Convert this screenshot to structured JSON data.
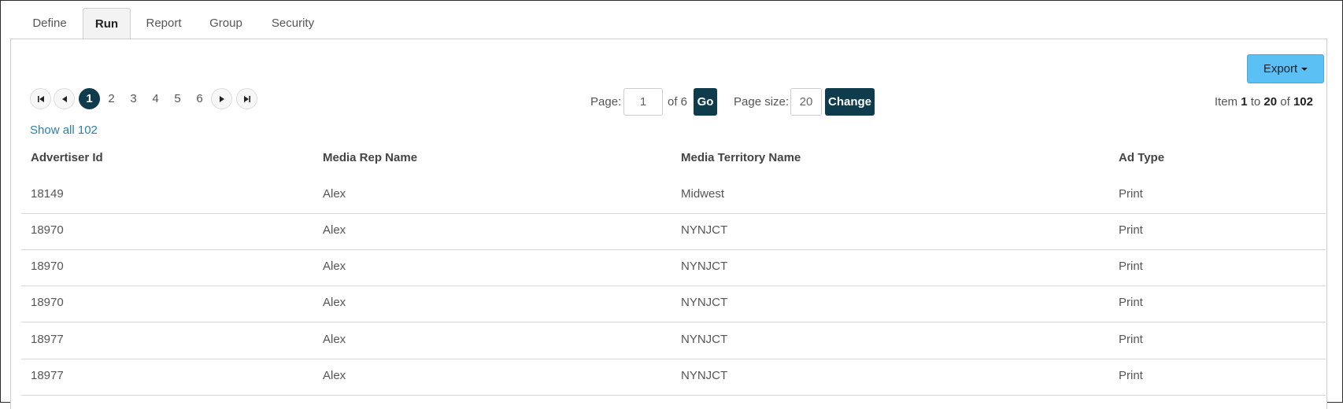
{
  "tabs": [
    {
      "label": "Define",
      "active": false
    },
    {
      "label": "Run",
      "active": true
    },
    {
      "label": "Report",
      "active": false
    },
    {
      "label": "Group",
      "active": false
    },
    {
      "label": "Security",
      "active": false
    }
  ],
  "export": {
    "label": "Export"
  },
  "pager": {
    "pages": [
      "1",
      "2",
      "3",
      "4",
      "5",
      "6"
    ],
    "current": "1",
    "show_all": "Show all 102"
  },
  "page_nav": {
    "page_label": "Page:",
    "page_value": "1",
    "of_label": "of 6",
    "go_label": "Go",
    "size_label": "Page size:",
    "size_value": "20",
    "change_label": "Change"
  },
  "range": {
    "item": "Item",
    "start": "1",
    "to": "to",
    "end": "20",
    "of": "of",
    "total": "102"
  },
  "table": {
    "columns": [
      "Advertiser Id",
      "Media Rep Name",
      "Media Territory Name",
      "Ad Type"
    ],
    "rows": [
      [
        "18149",
        "Alex",
        "Midwest",
        "Print"
      ],
      [
        "18970",
        "Alex",
        "NYNJCT",
        "Print"
      ],
      [
        "18970",
        "Alex",
        "NYNJCT",
        "Print"
      ],
      [
        "18970",
        "Alex",
        "NYNJCT",
        "Print"
      ],
      [
        "18977",
        "Alex",
        "NYNJCT",
        "Print"
      ],
      [
        "18977",
        "Alex",
        "NYNJCT",
        "Print"
      ]
    ]
  },
  "colors": {
    "accent_dark": "#0e3c4c",
    "export_bg": "#5bc0f4",
    "link": "#2b7fa8"
  }
}
